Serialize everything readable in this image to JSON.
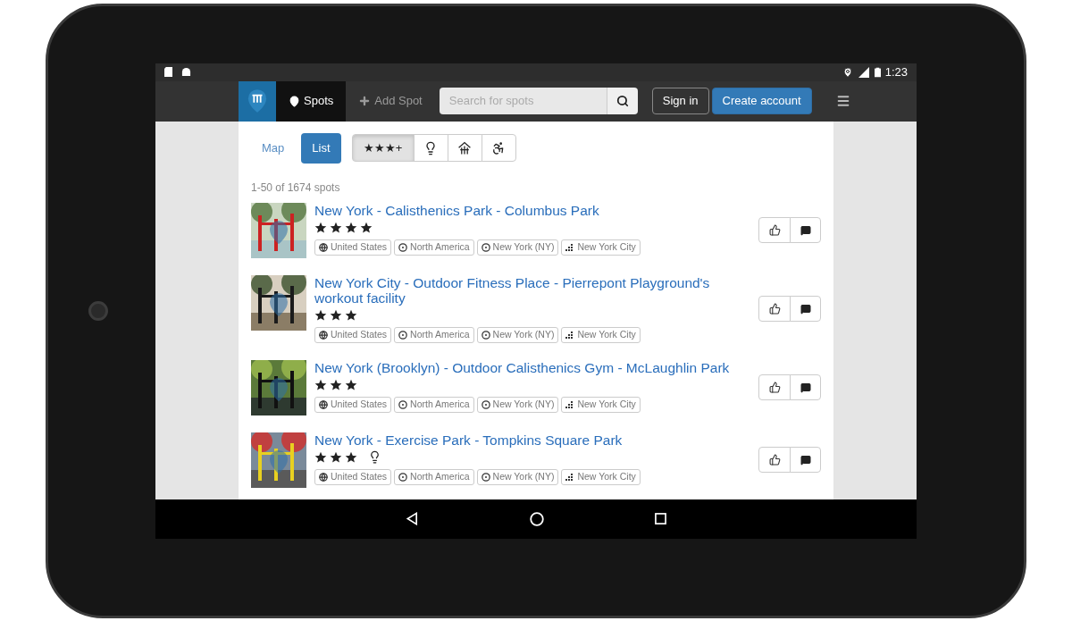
{
  "status_bar": {
    "time": "1:23"
  },
  "navbar": {
    "tabs": [
      {
        "label": "Spots",
        "kind": "pin",
        "selected": true
      },
      {
        "label": "Add Spot",
        "kind": "plus",
        "selected": false
      }
    ],
    "search": {
      "placeholder": "Search for spots"
    },
    "buttons": [
      {
        "label": "Sign in",
        "kind": "outline"
      },
      {
        "label": "Create account",
        "kind": "primary"
      }
    ]
  },
  "view_toggle": [
    {
      "label": "Map",
      "selected": false
    },
    {
      "label": "List",
      "selected": true
    }
  ],
  "filters": [
    {
      "kind": "rating",
      "label": "★★★+",
      "selected": true
    },
    {
      "kind": "lighting",
      "selected": false
    },
    {
      "kind": "building",
      "selected": false
    },
    {
      "kind": "accessible",
      "selected": false
    }
  ],
  "result_count": "1-50 of 1674 spots",
  "spots": [
    {
      "title": "New York - Calisthenics Park - Columbus Park",
      "stars": 4,
      "lighting": false,
      "tags": [
        {
          "kind": "country",
          "label": "United States"
        },
        {
          "kind": "region",
          "label": "North America"
        },
        {
          "kind": "region",
          "label": "New York (NY)"
        },
        {
          "kind": "city",
          "label": "New York City"
        }
      ]
    },
    {
      "title": "New York City - Outdoor Fitness Place - Pierrepont Playground's workout facility",
      "stars": 3,
      "lighting": false,
      "tags": [
        {
          "kind": "country",
          "label": "United States"
        },
        {
          "kind": "region",
          "label": "North America"
        },
        {
          "kind": "region",
          "label": "New York (NY)"
        },
        {
          "kind": "city",
          "label": "New York City"
        }
      ]
    },
    {
      "title": "New York (Brooklyn) - Outdoor Calisthenics Gym - McLaughlin Park",
      "stars": 3,
      "lighting": false,
      "tags": [
        {
          "kind": "country",
          "label": "United States"
        },
        {
          "kind": "region",
          "label": "North America"
        },
        {
          "kind": "region",
          "label": "New York (NY)"
        },
        {
          "kind": "city",
          "label": "New York City"
        }
      ]
    },
    {
      "title": "New York - Exercise Park - Tompkins Square Park",
      "stars": 3,
      "lighting": true,
      "tags": [
        {
          "kind": "country",
          "label": "United States"
        },
        {
          "kind": "region",
          "label": "North America"
        },
        {
          "kind": "region",
          "label": "New York (NY)"
        },
        {
          "kind": "city",
          "label": "New York City"
        }
      ]
    }
  ]
}
